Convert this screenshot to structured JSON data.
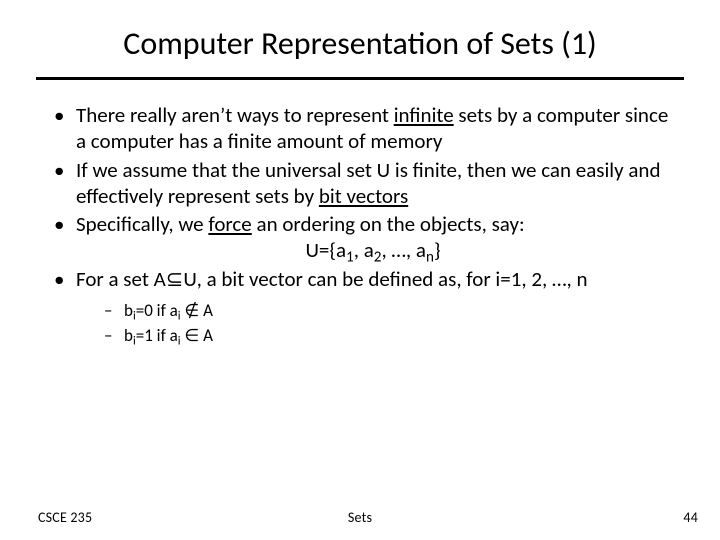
{
  "title": "Computer Representation of Sets (1)",
  "bullets": {
    "b1a": "There really aren",
    "b1apos": "’",
    "b1b": "t ways to represent ",
    "b1u": "infinite",
    "b1c": " sets by a computer since a computer has a finite amount of memory",
    "b2a": "If we assume that the universal set U is finite, then we can easily and effectively represent sets by ",
    "b2u": "bit vectors",
    "b3a": "Specifically, we ",
    "b3u": "force",
    "b3b": " an ordering on the objects, say:",
    "eq_pre": "U={a",
    "eq_s1": "1",
    "eq_mid1": ", a",
    "eq_s2": "2",
    "eq_mid2": ", …, a",
    "eq_sn": "n",
    "eq_post": "}",
    "b4a": "For a set A",
    "b4sub": "⊆",
    "b4b": "U, a bit vector can be defined as, for i=1, 2, …, n",
    "s1a": "b",
    "s1i": "i",
    "s1b": "=0 if a",
    "s1i2": "i",
    "s1c": " ∉ A",
    "s2a": "b",
    "s2i": "i",
    "s2b": "=1 if a",
    "s2i2": "i",
    "s2c": " ∈ A"
  },
  "footer": {
    "left": "CSCE 235",
    "center": "Sets",
    "right": "44"
  }
}
